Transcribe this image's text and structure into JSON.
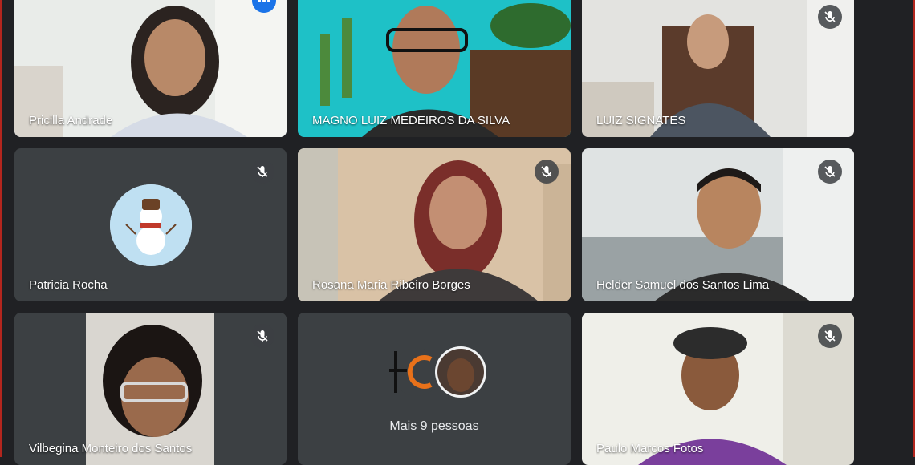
{
  "participants": [
    {
      "name": "Pricilla Andrade",
      "muted": false,
      "active_speaker": true
    },
    {
      "name": "MAGNO LUIZ MEDEIROS DA SILVA",
      "muted": false
    },
    {
      "name": "LUIZ SIGNATES",
      "muted": true
    },
    {
      "name": "Patricia Rocha",
      "muted": true
    },
    {
      "name": "Rosana Maria Ribeiro Borges",
      "muted": true
    },
    {
      "name": "Helder Samuel dos Santos Lima",
      "muted": true
    },
    {
      "name": "Vilbegina Monteiro dos Santos",
      "muted": true
    },
    {
      "name": "Paulo Marcos Fotos",
      "muted": true
    }
  ],
  "overflow_tile": {
    "label": "Mais 9 pessoas"
  },
  "colors": {
    "background": "#202124",
    "tile": "#3c4043",
    "active_border": "#8ab4f8",
    "accent": "#1a73e8"
  }
}
